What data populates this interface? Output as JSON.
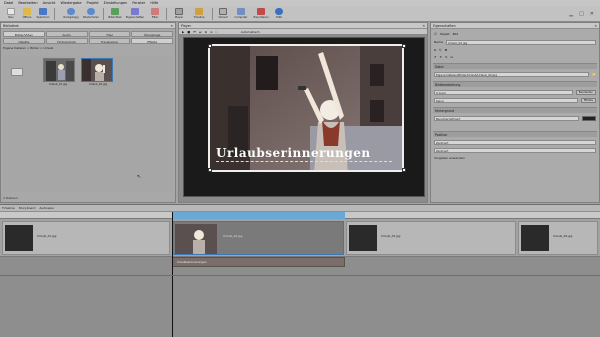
{
  "menu": [
    "Datei",
    "Bearbeiten",
    "Ansicht",
    "Wiedergabe",
    "Projekt",
    "Einstellungen",
    "Fenster",
    "Hilfe"
  ],
  "toolbar": [
    {
      "label": "Neu",
      "icon": "new-file-icon",
      "color": "#e8e8e8"
    },
    {
      "label": "Öffnen",
      "icon": "open-folder-icon",
      "color": "#e0b848"
    },
    {
      "label": "Speichern",
      "icon": "save-icon",
      "color": "#4a78c8"
    },
    {
      "label": "Rückgängig",
      "icon": "undo-icon",
      "color": "#5a8ad0"
    },
    {
      "label": "Wiederholen",
      "icon": "redo-icon",
      "color": "#5a8ad0"
    },
    {
      "label": "Bibliothek",
      "icon": "library-icon",
      "color": "#5aa05a"
    },
    {
      "label": "Eigenschaften",
      "icon": "properties-icon",
      "color": "#7a7ad0"
    },
    {
      "label": "Filter",
      "icon": "filter-icon",
      "color": "#d07a7a"
    },
    {
      "label": "Player",
      "icon": "player-icon",
      "color": "#a0a0a0"
    },
    {
      "label": "Timeline",
      "icon": "timeline-icon",
      "color": "#d0a040"
    },
    {
      "label": "Verlauf",
      "icon": "history-icon",
      "color": "#b0b0b0"
    },
    {
      "label": "Computer",
      "icon": "computer-icon",
      "color": "#7090c0"
    },
    {
      "label": "Exportieren",
      "icon": "export-icon",
      "color": "#c04a4a"
    },
    {
      "label": "Hilfe",
      "icon": "help-icon",
      "color": "#3a70c0"
    }
  ],
  "library": {
    "title": "Bibliothek",
    "tabs": [
      "Bilder/Video",
      "Audio",
      "Titel",
      "Übergänge"
    ],
    "tabs2": [
      "Objekte",
      "Hintergründe",
      "Transparenz",
      "Effekte"
    ],
    "path": "Eigene Dateien > Bilder > Urlaub",
    "items": [
      {
        "label": "Urlaub_01.jpg"
      },
      {
        "label": "Urlaub_02.jpg"
      }
    ],
    "status": "2 Dateien"
  },
  "player": {
    "title": "Player",
    "zoom": "Automatisch",
    "caption": "Urlaubserinnerungen"
  },
  "properties": {
    "title": "Eigenschaften",
    "rows": [
      {
        "label": "Objekt",
        "value": "Bild"
      },
      {
        "label": "Name",
        "value": "Urlaub_02.jpg"
      }
    ],
    "sections": [
      "Datei",
      "Bildbearbeitung",
      "Hintergrund",
      "Position"
    ],
    "file": "Eigene Dateien/Bilder/Urlaub/Urlaub_02.jpg",
    "rotation": "0 Grad",
    "flip": "Keine",
    "bg_color": "Benutzerdefiniert",
    "position_x": "Zentriert",
    "position_y": "Zentriert",
    "edit_button": "Bearbeiten",
    "effect_button": "Effekte",
    "preset_label": "Vorgaben anwenden"
  },
  "timeline": {
    "tabs": [
      "Timeline",
      "Storyboard",
      "Audiospur"
    ],
    "clips": [
      {
        "label": "Urlaub_01.jpg"
      },
      {
        "label": "Urlaub_02.jpg"
      },
      {
        "label": "Urlaub_03.jpg"
      },
      {
        "label": "Urlaub_04.jpg"
      }
    ],
    "subtrack_label": "Urlaubserinnerungen"
  }
}
